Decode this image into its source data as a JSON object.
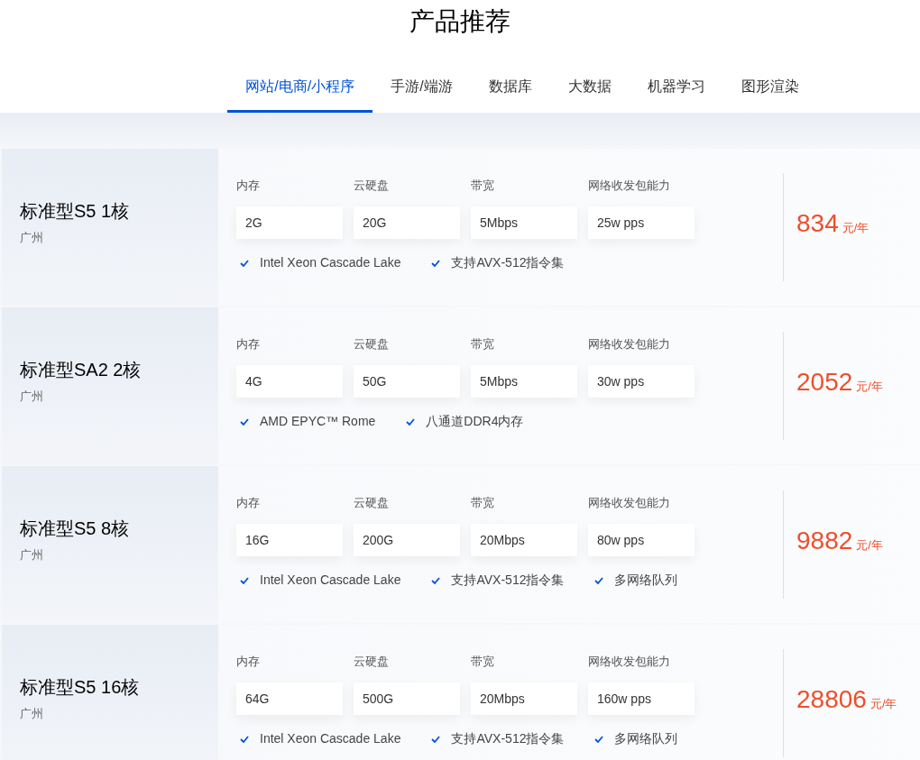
{
  "title": "产品推荐",
  "tabs": [
    {
      "label": "网站/电商/小程序",
      "selected": true
    },
    {
      "label": "手游/端游",
      "selected": false
    },
    {
      "label": "数据库",
      "selected": false
    },
    {
      "label": "大数据",
      "selected": false
    },
    {
      "label": "机器学习",
      "selected": false
    },
    {
      "label": "图形渲染",
      "selected": false
    }
  ],
  "products": [
    {
      "name": "标准型S5 1核",
      "region": "广州",
      "specs": [
        {
          "label": "内存",
          "value": "2G"
        },
        {
          "label": "云硬盘",
          "value": "20G"
        },
        {
          "label": "带宽",
          "value": "5Mbps"
        },
        {
          "label": "网络收发包能力",
          "value": "25w pps"
        }
      ],
      "features": [
        "Intel Xeon Cascade Lake",
        "支持AVX-512指令集"
      ],
      "price": "834",
      "unit": "元/年"
    },
    {
      "name": "标准型SA2 2核",
      "region": "广州",
      "specs": [
        {
          "label": "内存",
          "value": "4G"
        },
        {
          "label": "云硬盘",
          "value": "50G"
        },
        {
          "label": "带宽",
          "value": "5Mbps"
        },
        {
          "label": "网络收发包能力",
          "value": "30w pps"
        }
      ],
      "features": [
        "AMD EPYC™ Rome",
        "八通道DDR4内存"
      ],
      "price": "2052",
      "unit": "元/年"
    },
    {
      "name": "标准型S5 8核",
      "region": "广州",
      "specs": [
        {
          "label": "内存",
          "value": "16G"
        },
        {
          "label": "云硬盘",
          "value": "200G"
        },
        {
          "label": "带宽",
          "value": "20Mbps"
        },
        {
          "label": "网络收发包能力",
          "value": "80w pps"
        }
      ],
      "features": [
        "Intel Xeon Cascade Lake",
        "支持AVX-512指令集",
        "多网络队列"
      ],
      "price": "9882",
      "unit": "元/年"
    },
    {
      "name": "标准型S5 16核",
      "region": "广州",
      "specs": [
        {
          "label": "内存",
          "value": "64G"
        },
        {
          "label": "云硬盘",
          "value": "500G"
        },
        {
          "label": "带宽",
          "value": "20Mbps"
        },
        {
          "label": "网络收发包能力",
          "value": "160w pps"
        }
      ],
      "features": [
        "Intel Xeon Cascade Lake",
        "支持AVX-512指令集",
        "多网络队列"
      ],
      "price": "28806",
      "unit": "元/年"
    }
  ]
}
